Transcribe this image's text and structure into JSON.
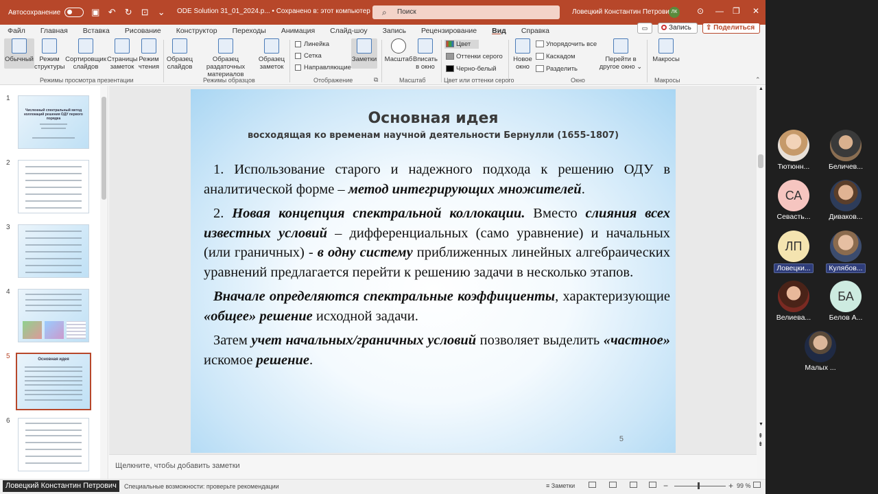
{
  "titlebar": {
    "autosave_label": "Автосохранение",
    "doc_title": "ODE Solution 31_01_2024.p...  •  Сохранено в: этот компьютер ⌄",
    "search_placeholder": "Поиск",
    "user_name": "Ловецкий Константин Петрович",
    "user_initials": "ЛК",
    "accent_color": "#b7472a"
  },
  "menu": {
    "items": [
      "Файл",
      "Главная",
      "Вставка",
      "Рисование",
      "Конструктор",
      "Переходы",
      "Анимация",
      "Слайд-шоу",
      "Запись",
      "Рецензирование",
      "Вид",
      "Справка"
    ],
    "active": "Вид",
    "record_label": "Запись",
    "share_label": "Поделиться"
  },
  "ribbon": {
    "groups": {
      "views": {
        "label": "Режимы просмотра презентации",
        "buttons": [
          "Обычный",
          "Режим структуры",
          "Сортировщик слайдов",
          "Страницы заметок",
          "Режим чтения"
        ]
      },
      "masters": {
        "label": "Режимы образцов",
        "buttons": [
          "Образец слайдов",
          "Образец раздаточных материалов",
          "Образец заметок"
        ]
      },
      "show": {
        "label": "Отображение",
        "checkboxes": [
          "Линейка",
          "Сетка",
          "Направляющие"
        ],
        "notes_button": "Заметки"
      },
      "zoom": {
        "label": "Масштаб",
        "buttons": [
          "Масштаб",
          "Вписать в окно"
        ]
      },
      "color": {
        "label": "Цвет или оттенки серого",
        "options": [
          "Цвет",
          "Оттенки серого",
          "Черно-белый"
        ]
      },
      "window": {
        "label": "Окно",
        "new_window": "Новое окно",
        "options": [
          "Упорядочить все",
          "Каскадом",
          "Разделить"
        ],
        "switch": "Перейти в другое окно ⌄"
      },
      "macros": {
        "label": "Макросы",
        "button": "Макросы"
      }
    }
  },
  "thumbnails": {
    "numbers": [
      "1",
      "2",
      "3",
      "4",
      "5",
      "6"
    ],
    "active_index": 5,
    "slide1_title": "Численный спектральный метод коллокаций решения ОДУ первого порядка",
    "slide5_title": "Основная идея"
  },
  "slide": {
    "title": "Основная идея",
    "subtitle": "восходящая ко временам научной деятельности Бернулли (1655-1807)",
    "p1_a": "1.  Использование старого и надежного подхода к решению ОДУ в аналитической форме – ",
    "p1_b": "метод интегрирующих множителей",
    "p1_c": ".",
    "p2_num": "2.  ",
    "p2_b1": "Новая концепция спектральной коллокации.",
    "p2_a": " Вместо ",
    "p2_b2": "слияния всех известных условий",
    "p2_c": " – дифференциальных (само уравнение) и начальных (или граничных) - ",
    "p2_b3": "в одну систему",
    "p2_d": " приближенных линейных алгебраических уравнений предлагается перейти к решению задачи в несколько этапов.",
    "p3_b1": "Вначале определяются спектральные коэффициенты",
    "p3_a": ", характеризующие ",
    "p3_b2": "«общее» решение",
    "p3_c": " исходной задачи.",
    "p4_a": "Затем ",
    "p4_b1": "учет начальных/граничных условий",
    "p4_c": " позволяет выделить ",
    "p4_b2": "«частное»",
    "p4_d": " искомое ",
    "p4_b3": "решение",
    "p4_e": ".",
    "number": "5"
  },
  "notes_placeholder": "Щелкните, чтобы добавить заметки",
  "statusbar": {
    "presenter": "Ловецкий Константин Петрович",
    "accessibility": "Специальные возможности: проверьте рекомендации",
    "notes": "Заметки",
    "zoom": "99 %"
  },
  "participants": [
    {
      "name": "Тютюнн...",
      "initials": "",
      "photo": "a"
    },
    {
      "name": "Беличев...",
      "initials": "",
      "photo": "b"
    },
    {
      "name": "Севасть...",
      "initials": "СА",
      "color": "#f6c5c0"
    },
    {
      "name": "Диваков...",
      "initials": "",
      "photo": "c"
    },
    {
      "name": "Ловецки...",
      "initials": "ЛП",
      "color": "#f4e4b0",
      "highlight": true
    },
    {
      "name": "Кулябов...",
      "initials": "",
      "photo": "d",
      "highlight": true
    },
    {
      "name": "Велиева...",
      "initials": "",
      "photo": "e"
    },
    {
      "name": "Белов А...",
      "initials": "БА",
      "color": "#cdebe0"
    },
    {
      "name": "Малых ...",
      "initials": "",
      "photo": "f"
    }
  ]
}
